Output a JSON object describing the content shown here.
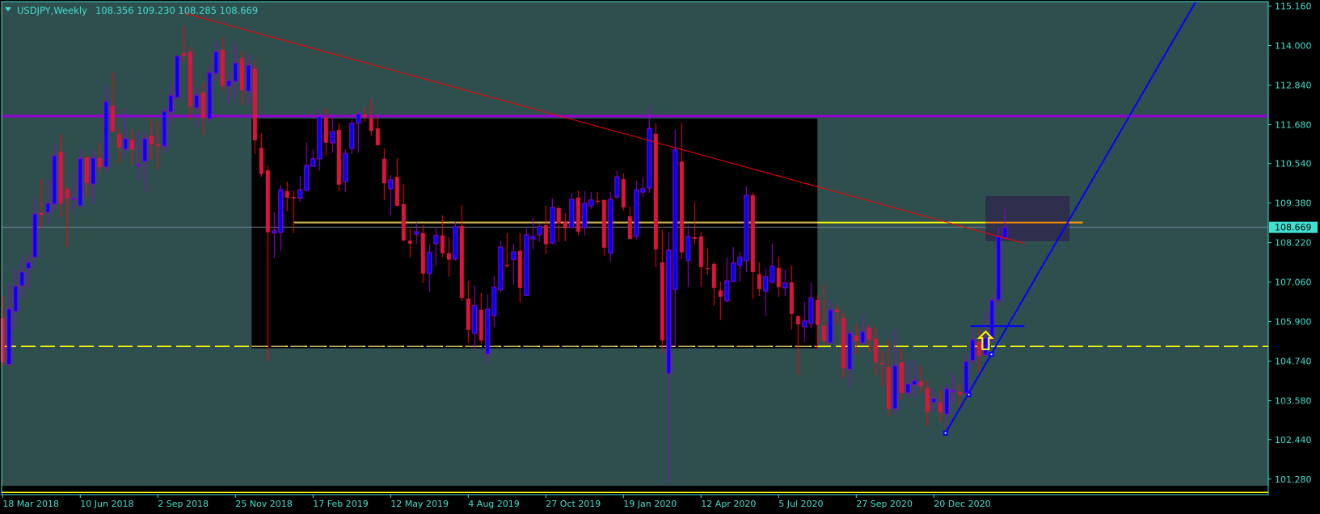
{
  "header": {
    "symbol_timeframe": "USDJPY,Weekly",
    "ohlc_text": "108.356 109.230 108.285 108.669",
    "menu_icon": "triangle-down-icon"
  },
  "price_scale": {
    "labels": [
      "115.160",
      "114.000",
      "112.840",
      "111.680",
      "110.540",
      "109.380",
      "108.220",
      "107.060",
      "105.900",
      "104.740",
      "103.580",
      "102.440",
      "101.280"
    ],
    "current_price_label": "108.669"
  },
  "time_scale": {
    "labels": [
      "18 Mar 2018",
      "10 Jun 2018",
      "2 Sep 2018",
      "25 Nov 2018",
      "17 Feb 2019",
      "12 May 2019",
      "4 Aug 2019",
      "27 Oct 2019",
      "19 Jan 2020",
      "12 Apr 2020",
      "5 Jul 2020",
      "27 Sep 2020",
      "20 Dec 2020"
    ],
    "label_every_n_bars": 12
  },
  "colors": {
    "background": "#2F4F4F",
    "bull_body": "#0000FF",
    "bull_outline": "#9400D3",
    "bear_body": "#DC143C",
    "bear_wick": "#FF0000",
    "text": "#40E0D0",
    "resistance_line": "#9400D3",
    "level_line": "#FFFF00",
    "level_line_in_box": "#C8AC5C",
    "trend_red": "#FF0000",
    "trend_blue": "#0000FF",
    "price_line": "#778899",
    "zone_box": "#2E2B4C",
    "range_box": "#000000"
  },
  "chart_data": {
    "type": "candlestick",
    "title": "USDJPY,Weekly",
    "ylim": [
      101.28,
      115.16
    ],
    "x_unit": "weekly bar index (0 = week of 18 Mar 2018)",
    "ohlc_order": [
      "open",
      "high",
      "low",
      "close"
    ],
    "candles": [
      [
        106.01,
        106.65,
        104.61,
        104.71
      ],
      [
        104.65,
        107.03,
        104.57,
        106.27
      ],
      [
        106.2,
        107.48,
        105.66,
        106.94
      ],
      [
        106.96,
        107.79,
        106.6,
        107.36
      ],
      [
        107.46,
        107.88,
        106.86,
        107.64
      ],
      [
        107.79,
        109.56,
        107.64,
        109.07
      ],
      [
        109.09,
        110.08,
        108.64,
        109.04
      ],
      [
        109.11,
        110.06,
        108.76,
        109.37
      ],
      [
        109.35,
        111.1,
        109.18,
        110.77
      ],
      [
        110.89,
        111.41,
        108.97,
        109.37
      ],
      [
        109.78,
        109.85,
        108.09,
        109.52
      ],
      [
        109.49,
        110.3,
        109.18,
        109.52
      ],
      [
        109.3,
        110.96,
        109.28,
        110.68
      ],
      [
        110.72,
        110.77,
        109.54,
        109.96
      ],
      [
        109.94,
        110.96,
        109.35,
        110.7
      ],
      [
        110.7,
        111.15,
        110.3,
        110.44
      ],
      [
        110.44,
        112.83,
        110.32,
        112.36
      ],
      [
        112.24,
        113.21,
        111.46,
        111.48
      ],
      [
        111.41,
        111.55,
        110.56,
        111.01
      ],
      [
        110.96,
        112.17,
        110.77,
        111.27
      ],
      [
        111.24,
        111.55,
        110.53,
        110.94
      ],
      [
        110.49,
        111.48,
        110.08,
        110.51
      ],
      [
        110.6,
        111.48,
        109.73,
        111.27
      ],
      [
        111.36,
        111.86,
        110.67,
        111.1
      ],
      [
        111.1,
        111.79,
        110.37,
        111.05
      ],
      [
        111.05,
        112.19,
        110.84,
        112.07
      ],
      [
        112.05,
        112.9,
        111.67,
        112.54
      ],
      [
        112.47,
        113.7,
        112.43,
        113.7
      ],
      [
        113.78,
        114.58,
        113.52,
        113.7
      ],
      [
        113.82,
        113.97,
        111.83,
        112.21
      ],
      [
        112.17,
        112.78,
        111.62,
        112.54
      ],
      [
        112.62,
        112.9,
        111.38,
        111.88
      ],
      [
        111.86,
        113.42,
        111.76,
        113.21
      ],
      [
        113.18,
        114.11,
        112.95,
        113.82
      ],
      [
        113.87,
        114.25,
        112.66,
        112.81
      ],
      [
        112.81,
        113.23,
        112.31,
        112.97
      ],
      [
        112.95,
        114.08,
        112.45,
        113.49
      ],
      [
        113.63,
        113.85,
        112.26,
        112.69
      ],
      [
        112.66,
        113.73,
        112.26,
        113.42
      ],
      [
        113.33,
        113.56,
        110.82,
        111.22
      ],
      [
        111.0,
        111.43,
        110.15,
        110.23
      ],
      [
        110.34,
        110.49,
        104.73,
        108.52
      ],
      [
        108.5,
        109.11,
        107.76,
        108.57
      ],
      [
        108.52,
        109.92,
        107.98,
        109.77
      ],
      [
        109.73,
        110.01,
        109.14,
        109.54
      ],
      [
        109.56,
        109.75,
        108.5,
        109.52
      ],
      [
        109.52,
        110.18,
        109.42,
        109.77
      ],
      [
        109.75,
        111.15,
        109.73,
        110.49
      ],
      [
        110.46,
        110.96,
        110.44,
        110.68
      ],
      [
        110.68,
        112.1,
        110.34,
        111.93
      ],
      [
        111.88,
        112.17,
        110.77,
        111.15
      ],
      [
        111.15,
        111.91,
        110.86,
        111.48
      ],
      [
        111.53,
        111.72,
        109.73,
        109.92
      ],
      [
        110.01,
        110.96,
        109.7,
        110.84
      ],
      [
        110.98,
        111.83,
        110.82,
        111.72
      ],
      [
        111.72,
        112.1,
        110.86,
        112.0
      ],
      [
        111.98,
        112.19,
        111.76,
        111.91
      ],
      [
        111.88,
        112.43,
        111.36,
        111.5
      ],
      [
        111.57,
        111.93,
        111.05,
        111.08
      ],
      [
        110.68,
        110.98,
        109.47,
        109.96
      ],
      [
        109.8,
        110.2,
        109.02,
        110.06
      ],
      [
        110.15,
        110.7,
        109.28,
        109.3
      ],
      [
        109.35,
        109.94,
        108.26,
        108.28
      ],
      [
        108.28,
        108.64,
        107.79,
        108.19
      ],
      [
        108.47,
        108.83,
        108.17,
        108.54
      ],
      [
        108.5,
        108.73,
        107.03,
        107.31
      ],
      [
        107.31,
        108.17,
        106.77,
        107.93
      ],
      [
        108.19,
        108.66,
        107.53,
        108.43
      ],
      [
        108.43,
        109.02,
        107.79,
        107.91
      ],
      [
        107.91,
        108.38,
        107.22,
        107.72
      ],
      [
        107.74,
        108.85,
        107.69,
        108.69
      ],
      [
        108.71,
        109.33,
        106.51,
        106.6
      ],
      [
        106.58,
        107.1,
        105.28,
        105.66
      ],
      [
        105.56,
        106.98,
        105.07,
        106.37
      ],
      [
        106.25,
        106.75,
        105.23,
        105.35
      ],
      [
        104.95,
        106.7,
        104.69,
        106.27
      ],
      [
        106.08,
        107.24,
        105.73,
        106.91
      ],
      [
        106.84,
        108.28,
        106.75,
        108.09
      ],
      [
        107.57,
        108.5,
        107.48,
        107.55
      ],
      [
        107.72,
        108.19,
        106.98,
        107.95
      ],
      [
        107.98,
        108.5,
        106.46,
        106.89
      ],
      [
        106.67,
        108.64,
        106.65,
        108.45
      ],
      [
        108.33,
        108.95,
        108.02,
        108.4
      ],
      [
        108.45,
        108.78,
        108.24,
        108.69
      ],
      [
        108.73,
        109.3,
        107.88,
        108.17
      ],
      [
        108.21,
        109.52,
        108.17,
        109.25
      ],
      [
        109.23,
        109.3,
        108.24,
        108.78
      ],
      [
        108.83,
        109.09,
        108.26,
        108.64
      ],
      [
        108.66,
        109.68,
        108.64,
        109.49
      ],
      [
        109.54,
        109.75,
        108.43,
        108.54
      ],
      [
        108.66,
        109.73,
        108.43,
        109.37
      ],
      [
        109.3,
        109.7,
        109.21,
        109.47
      ],
      [
        109.45,
        109.7,
        109.33,
        109.44
      ],
      [
        109.47,
        109.49,
        107.84,
        108.07
      ],
      [
        107.91,
        109.7,
        107.65,
        109.49
      ],
      [
        109.56,
        110.32,
        109.49,
        110.15
      ],
      [
        110.08,
        110.25,
        109.16,
        109.25
      ],
      [
        108.99,
        109.28,
        108.31,
        108.33
      ],
      [
        108.4,
        110.04,
        108.31,
        109.77
      ],
      [
        109.7,
        110.15,
        109.56,
        109.8
      ],
      [
        109.82,
        112.21,
        109.68,
        111.57
      ],
      [
        111.41,
        111.72,
        107.5,
        108.02
      ],
      [
        107.64,
        108.59,
        104.99,
        105.35
      ],
      [
        104.38,
        108.52,
        101.16,
        108.0
      ],
      [
        106.84,
        111.53,
        105.16,
        110.94
      ],
      [
        110.6,
        111.74,
        107.74,
        107.93
      ],
      [
        107.69,
        108.73,
        106.91,
        108.4
      ],
      [
        108.38,
        109.4,
        108.19,
        108.33
      ],
      [
        108.4,
        108.54,
        106.91,
        107.5
      ],
      [
        107.48,
        108.05,
        107.27,
        107.46
      ],
      [
        107.6,
        107.64,
        106.37,
        106.89
      ],
      [
        106.82,
        107.08,
        105.96,
        106.63
      ],
      [
        106.51,
        107.79,
        106.48,
        107.1
      ],
      [
        107.08,
        108.09,
        107.05,
        107.62
      ],
      [
        107.55,
        107.95,
        107.08,
        107.79
      ],
      [
        107.69,
        109.87,
        107.36,
        109.61
      ],
      [
        109.61,
        109.7,
        106.56,
        107.36
      ],
      [
        107.29,
        107.64,
        106.65,
        106.86
      ],
      [
        106.79,
        107.46,
        106.06,
        107.22
      ],
      [
        107.05,
        108.19,
        107.03,
        107.53
      ],
      [
        107.48,
        107.81,
        106.63,
        106.91
      ],
      [
        106.89,
        107.43,
        106.65,
        107.03
      ],
      [
        107.05,
        107.55,
        105.66,
        106.13
      ],
      [
        106.06,
        106.11,
        104.33,
        105.82
      ],
      [
        105.75,
        106.48,
        105.3,
        105.92
      ],
      [
        105.85,
        107.05,
        105.7,
        106.6
      ],
      [
        106.53,
        106.67,
        105.09,
        105.8
      ],
      [
        105.78,
        106.96,
        105.21,
        105.33
      ],
      [
        105.28,
        106.53,
        105.26,
        106.25
      ],
      [
        106.25,
        106.39,
        105.8,
        106.18
      ],
      [
        106.01,
        106.15,
        104.26,
        104.54
      ],
      [
        104.5,
        105.68,
        104.0,
        105.56
      ],
      [
        105.49,
        105.82,
        104.95,
        105.33
      ],
      [
        105.28,
        106.11,
        105.26,
        105.61
      ],
      [
        105.73,
        105.8,
        105.02,
        105.37
      ],
      [
        105.4,
        105.73,
        104.33,
        104.71
      ],
      [
        104.69,
        105.06,
        104.02,
        104.66
      ],
      [
        104.57,
        105.35,
        103.15,
        103.34
      ],
      [
        103.34,
        105.68,
        103.17,
        104.61
      ],
      [
        104.71,
        105.11,
        103.62,
        103.81
      ],
      [
        103.81,
        104.76,
        103.67,
        104.07
      ],
      [
        104.05,
        104.76,
        103.67,
        104.17
      ],
      [
        104.14,
        104.59,
        103.81,
        104.0
      ],
      [
        103.95,
        104.16,
        102.84,
        103.26
      ],
      [
        103.53,
        103.9,
        103.24,
        103.64
      ],
      [
        103.53,
        103.9,
        102.96,
        103.24
      ],
      [
        103.19,
        104.09,
        102.63,
        103.93
      ],
      [
        103.86,
        104.4,
        103.5,
        103.88
      ],
      [
        103.83,
        104.05,
        103.34,
        103.76
      ],
      [
        103.81,
        104.95,
        103.69,
        104.73
      ],
      [
        104.76,
        105.75,
        104.61,
        105.37
      ],
      [
        105.3,
        105.68,
        104.4,
        104.9
      ],
      [
        104.92,
        106.22,
        104.9,
        105.42
      ],
      [
        105.4,
        106.7,
        105.28,
        106.53
      ],
      [
        106.53,
        108.66,
        106.37,
        108.4
      ],
      [
        108.356,
        109.23,
        108.285,
        108.669
      ]
    ],
    "overlays": {
      "resistance_level": 111.93,
      "current_price": 108.669,
      "yellow_level": {
        "price": 108.81,
        "from_bar": 45,
        "to_bar": 167
      },
      "support_dashed_level": 105.175,
      "range_box": {
        "from_bar": 38.5,
        "to_bar": 126,
        "top": 111.86,
        "bottom": 105.12
      },
      "zone_box": {
        "from_bar": 152,
        "to_bar": 165,
        "top": 109.59,
        "bottom": 108.26
      },
      "red_trendline": [
        [
          28,
          114.96
        ],
        [
          158.1,
          108.19
        ]
      ],
      "blue_trendline": [
        [
          145.8,
          102.63
        ],
        [
          184.5,
          115.29
        ]
      ],
      "blue_trendline_anchors": [
        [
          145.8,
          102.63
        ],
        [
          149.4,
          103.76
        ],
        [
          152.9,
          104.94
        ]
      ],
      "blue_horizontal": {
        "price": 105.77,
        "from_bar": 149.7,
        "to_bar": 158
      },
      "buy_arrow": {
        "bar": 152,
        "tip": 105.61,
        "base": 105.09
      }
    }
  }
}
